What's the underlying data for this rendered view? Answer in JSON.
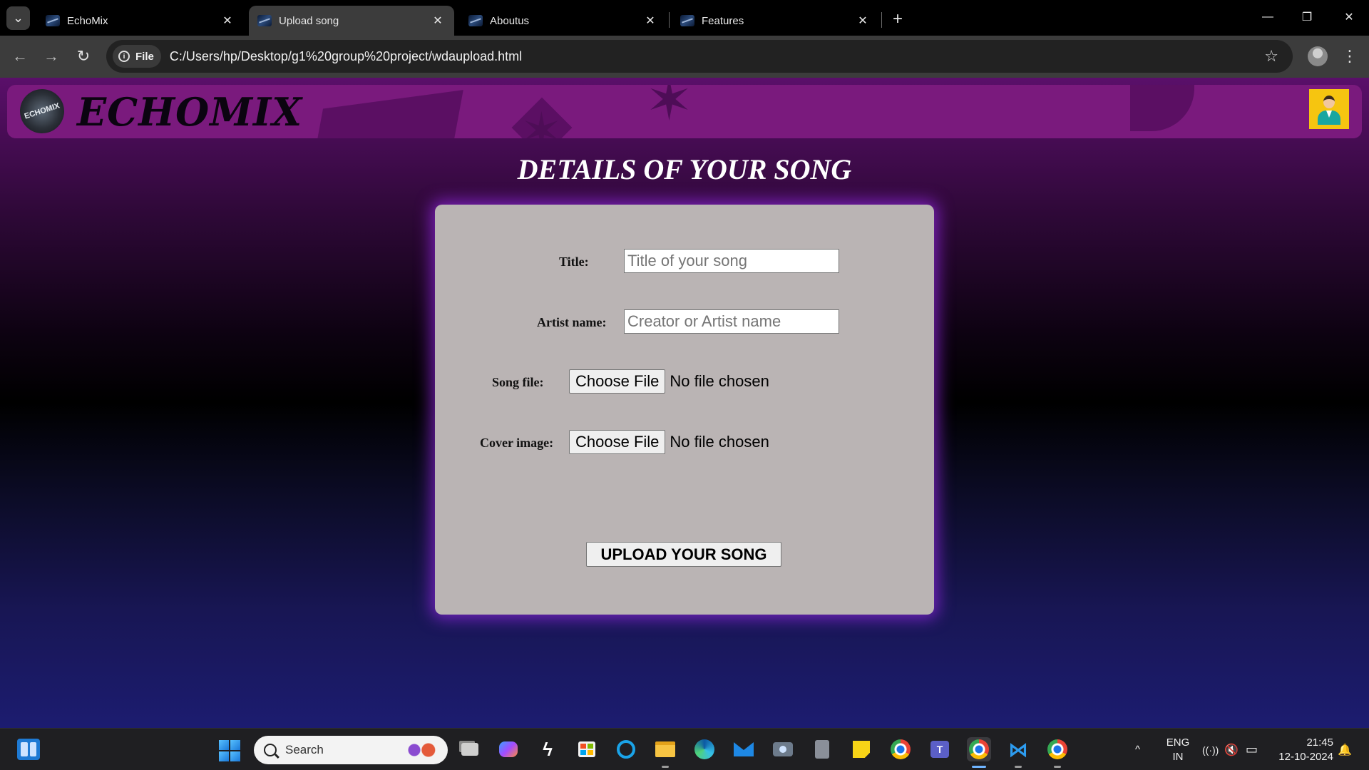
{
  "browser": {
    "tabs": [
      {
        "title": "EchoMix",
        "active": false
      },
      {
        "title": "Upload song",
        "active": true
      },
      {
        "title": "Aboutus",
        "active": false
      },
      {
        "title": "Features",
        "active": false
      }
    ],
    "close_glyph": "✕",
    "new_tab_glyph": "+",
    "site_chip_label": "File",
    "url": "C:/Users/hp/Desktop/g1%20group%20project/wdaupload.html",
    "icons": {
      "back": "←",
      "forward": "→",
      "reload": "↻",
      "star": "☆",
      "menu": "⋮",
      "minimize": "—",
      "restore": "❐",
      "close": "✕",
      "tab_search": "⌄"
    }
  },
  "site": {
    "brand": "ECHOMIX",
    "logo_text": "ECHOMIX",
    "colors": {
      "header": "#7a1a7d",
      "card": "#bab4b4",
      "avatar_bg": "#f6c510"
    }
  },
  "form": {
    "heading": "DETAILS OF YOUR SONG",
    "title_label": "Title:",
    "title_placeholder": "Title of your song",
    "artist_label": "Artist name:",
    "artist_placeholder": "Creator or Artist name",
    "song_file_label": "Song file:",
    "cover_label": "Cover image:",
    "choose_file": "Choose File",
    "no_file": "No file chosen",
    "submit_label": "UPLOAD YOUR SONG"
  },
  "taskbar": {
    "search_label": "Search",
    "language": "ENG",
    "region": "IN",
    "time": "21:45",
    "date": "12-10-2024",
    "tray_chevron": "^",
    "wifi": "((·))",
    "volume": "🔇",
    "battery": "▭",
    "bell": "🔔"
  }
}
